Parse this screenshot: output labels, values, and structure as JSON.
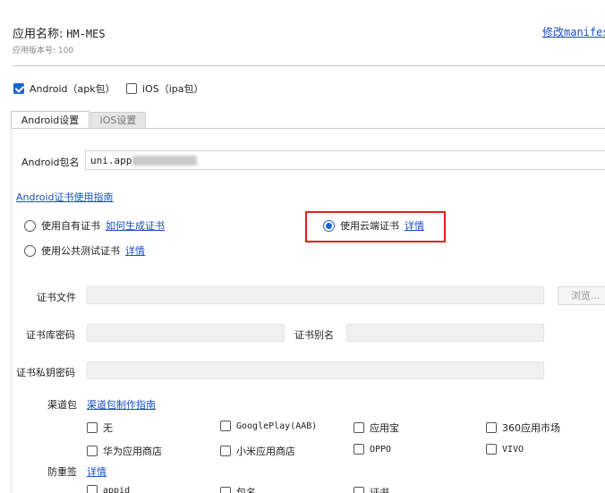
{
  "header": {
    "app_name_label": "应用名称:",
    "app_name_value": "HM-MES",
    "version_label": "应用版本号:",
    "version_value": "100",
    "edit_manifest_link": "修改manifest"
  },
  "platforms": {
    "android_label": "Android（apk包）",
    "android_checked": true,
    "ios_label": "iOS（ipa包）",
    "ios_checked": false
  },
  "tabs": [
    {
      "label": "Android设置",
      "active": true
    },
    {
      "label": "iOS设置",
      "active": false
    }
  ],
  "android": {
    "package_label": "Android包名",
    "package_value": "uni.app.",
    "cert_guide_link": "Android证书使用指南",
    "cert_options": {
      "own": {
        "label": "使用自有证书",
        "link": "如何生成证书",
        "selected": false
      },
      "public": {
        "label": "使用公共测试证书",
        "link": "详情",
        "selected": false
      },
      "cloud": {
        "label": "使用云端证书",
        "link": "详情",
        "selected": true
      }
    },
    "cert_file_label": "证书文件",
    "cert_file_value": "",
    "browse_button": "浏览...",
    "keystore_password_label": "证书库密码",
    "keystore_password_value": "",
    "alias_label": "证书别名",
    "alias_value": "",
    "key_password_label": "证书私钥密码",
    "key_password_value": ""
  },
  "channel": {
    "label": "渠道包",
    "guide_link": "渠道包制作指南",
    "options": [
      {
        "label": "无",
        "checked": false
      },
      {
        "label": "GooglePlay(AAB)",
        "checked": false
      },
      {
        "label": "应用宝",
        "checked": false
      },
      {
        "label": "360应用市场",
        "checked": false
      },
      {
        "label": "华为应用商店",
        "checked": false
      },
      {
        "label": "小米应用商店",
        "checked": false
      },
      {
        "label": "OPPO",
        "checked": false
      },
      {
        "label": "VIVO",
        "checked": false
      }
    ]
  },
  "anti_repack": {
    "label": "防重签",
    "link": "详情",
    "options": [
      {
        "label": "appid",
        "checked": false
      },
      {
        "label": "包名",
        "checked": false
      },
      {
        "label": "证书",
        "checked": false
      }
    ]
  },
  "colors": {
    "accent": "#1a66d2",
    "link": "#1a4ec2",
    "highlight_border": "#e02020"
  }
}
